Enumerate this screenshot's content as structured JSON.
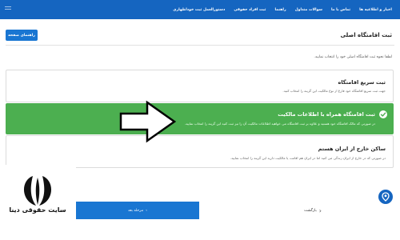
{
  "nav": {
    "links": [
      "اخبار و اطلاعیه ها",
      "تماس با ما",
      "سوالات متداول",
      "راهنما",
      "ثبت افراد حقوقی",
      "دستورالعمل ثبت خوداظهاری"
    ]
  },
  "page": {
    "title": "ثبت اقامتگاه اصلی",
    "help_button": "راهنمای صفحه",
    "instruction": "لطفا نحوه ثبت اقامتگاه اصلی خود را انتخاب نمایید."
  },
  "options": [
    {
      "title": "ثبت سریع اقامتگاه",
      "desc": "جهت ثبت سریع اقامتگاه خود فارغ از نوع مالکیت این گزینه را انتخاب کنید."
    },
    {
      "title": "ثبت اقامتگاه همراه با اطلاعات مالکیت",
      "desc": "در صورتی که مالک اقامتگاه خود هستید و علاوه بر ثبت اقامتگاه می خواهید اطلاعات مالکیت آن را نیز ثبت کنید این گزینه را انتخاب نمایید.",
      "selected": true
    },
    {
      "title": "ساکن خارج از ایران هستم",
      "desc": "در صورتی که در خارج از ایران زندگی می کنید اما در ایران هم اقامت یا مالکیت دارید این گزینه را انتخاب نمایید."
    }
  ],
  "footer": {
    "next": "مرحله بعد",
    "prev": "بازگشت"
  },
  "logo": {
    "text": "سایت حقوقی دینا"
  },
  "colors": {
    "primary": "#1565c0",
    "selected": "#4caf50"
  },
  "icons": {
    "selected": "check-icon",
    "annotation": "arrow-pointer-icon",
    "fab": "location-pin-icon"
  }
}
